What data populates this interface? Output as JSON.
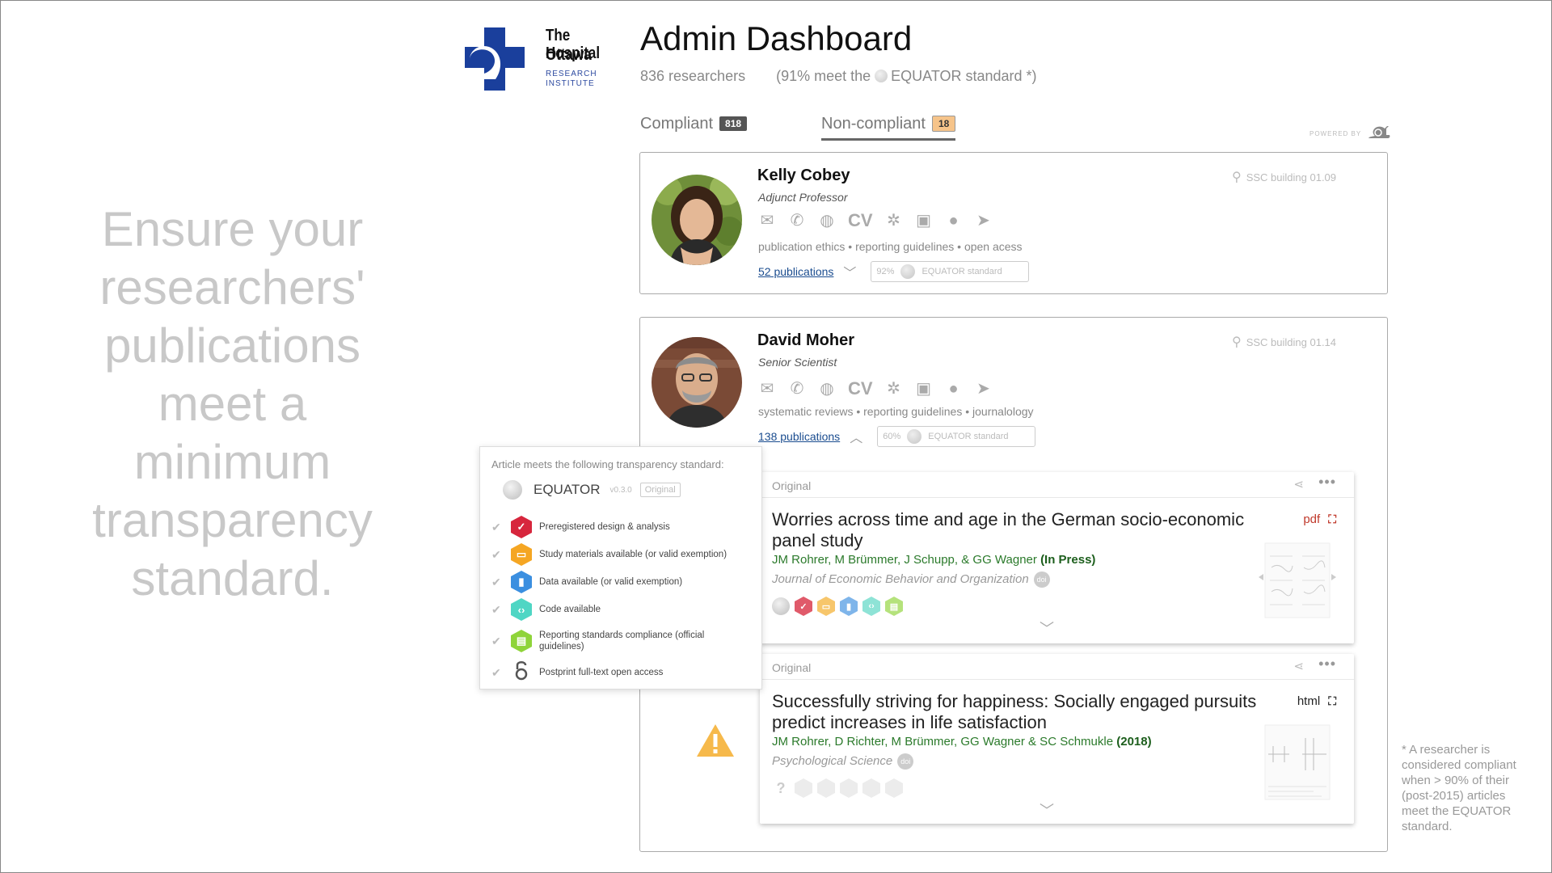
{
  "logo": {
    "name_line1": "The Ottawa",
    "name_line2": "Hospital",
    "sub_line1": "RESEARCH",
    "sub_line2": "INSTITUTE",
    "color": "#1a3f9c"
  },
  "header": {
    "title": "Admin Dashboard",
    "researchers": "836 researchers",
    "compliance_prefix": "(91% meet the",
    "compliance_suffix": "EQUATOR standard *)"
  },
  "tabs": {
    "compliant_label": "Compliant",
    "compliant_count": "818",
    "noncompliant_label": "Non-compliant",
    "noncompliant_count": "18"
  },
  "powered_by": "POWERED BY",
  "hero": {
    "text": "Ensure your researchers' publications meet a minimum transparency standard."
  },
  "footnote": "* A researcher is considered compliant when > 90% of their (post-2015) articles meet the EQUATOR standard.",
  "researchers": [
    {
      "name": "Kelly Cobey",
      "role": "Adjunct Professor",
      "location": "SSC building 01.09",
      "contact_cv": "CV",
      "keywords": "publication ethics • reporting guidelines • open acess",
      "publications": "52 publications",
      "equator_pct": "92%",
      "equator_label": "EQUATOR standard"
    },
    {
      "name": "David Moher",
      "role": "Senior Scientist",
      "location": "SSC building 01.14",
      "contact_cv": "CV",
      "keywords": "systematic reviews • reporting guidelines • journalology",
      "publications": "138 publications",
      "equator_pct": "60%",
      "equator_label": "EQUATOR standard"
    }
  ],
  "articles": [
    {
      "header_label": "Original",
      "title": "Worries across time and age in the German socio-economic panel study",
      "authors": "JM Rohrer, M Brümmer, J Schupp, & GG Wagner",
      "status": "(In Press)",
      "journal": "Journal of Economic Behavior and Organization",
      "doi": "doi",
      "format": "pdf"
    },
    {
      "header_label": "Original",
      "title": "Successfully striving for happiness: Socially engaged pursuits predict increases in life satisfaction",
      "authors": "JM Rohrer, D Richter, M Brümmer, GG Wagner & SC Schmukle",
      "status": "(2018)",
      "journal": "Psychological Science",
      "doi": "doi",
      "format": "html"
    }
  ],
  "popover": {
    "heading": "Article meets the following transparency standard:",
    "standard": "EQUATOR",
    "version": "v0.3.0",
    "type": "Original",
    "items": [
      {
        "label": "Preregistered design & analysis",
        "icon": "check-hex-icon",
        "color": "#d7263d"
      },
      {
        "label": "Study materials available (or valid exemption)",
        "icon": "box-hex-icon",
        "color": "#f5a623"
      },
      {
        "label": "Data available (or valid exemption)",
        "icon": "chart-hex-icon",
        "color": "#3b8fe0"
      },
      {
        "label": "Code available",
        "icon": "code-hex-icon",
        "color": "#4fd6c4"
      },
      {
        "label": "Reporting standards compliance (official guidelines)",
        "icon": "document-hex-icon",
        "color": "#8fd43a"
      },
      {
        "label": "Postprint full-text open access",
        "icon": "open-lock-icon",
        "color": "#555555"
      }
    ]
  },
  "colors": {
    "accent_green": "#2b7a2b",
    "pdf_red": "#c0392b",
    "warning": "#f6b94b",
    "link": "#1a4c8f"
  }
}
